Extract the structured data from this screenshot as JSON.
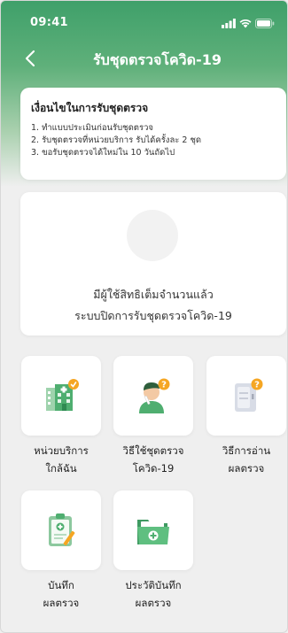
{
  "status": {
    "time": "09:41"
  },
  "nav": {
    "title": "รับชุดตรวจโควิด-19"
  },
  "conditions": {
    "title": "เงื่อนไขในการรับชุดตรวจ",
    "items": [
      "1. ทำแบบประเมินก่อนรับชุดตรวจ",
      "2. รับชุดตรวจที่หน่วยบริการ รับได้ครั้งละ 2 ชุด",
      "3. ขอรับชุดตรวจได้ใหม่ใน 10 วันถัดไป"
    ]
  },
  "closed": {
    "line1": "มีผู้ใช้สิทธิเต็มจำนวนแล้ว",
    "line2": "ระบบปิดการรับชุดตรวจโควิด-19"
  },
  "menu": [
    {
      "line1": "หน่วยบริการ",
      "line2": "ใกล้ฉัน",
      "icon": "hospital-icon"
    },
    {
      "line1": "วิธีใช้ชุดตรวจ",
      "line2": "โควิด-19",
      "icon": "test-help-icon"
    },
    {
      "line1": "วิธีการอ่าน",
      "line2": "ผลตรวจ",
      "icon": "read-result-icon"
    },
    {
      "line1": "บันทึก",
      "line2": "ผลตรวจ",
      "icon": "record-clipboard-icon"
    },
    {
      "line1": "ประวัติบันทึก",
      "line2": "ผลตรวจ",
      "icon": "history-folder-icon"
    }
  ],
  "colors": {
    "primary": "#3fa06a",
    "accent": "#f5a623"
  }
}
